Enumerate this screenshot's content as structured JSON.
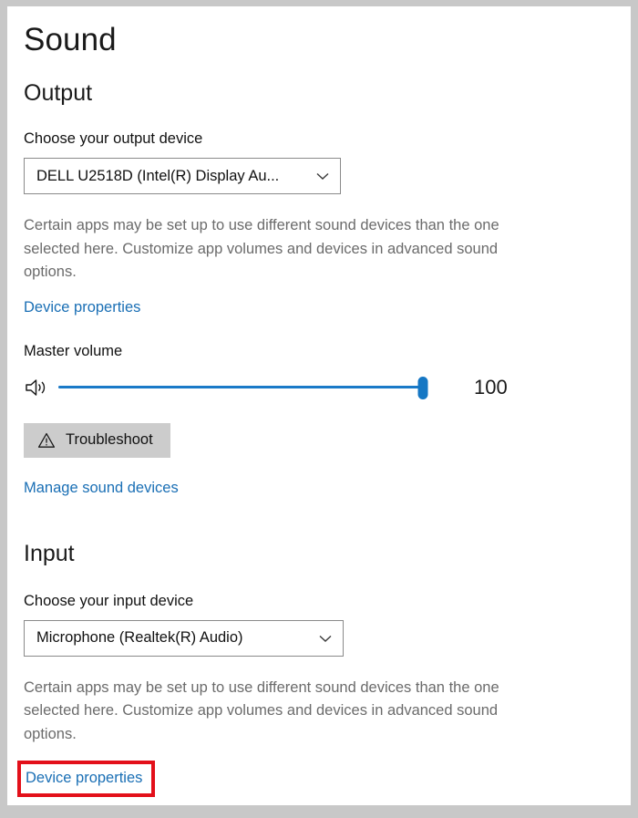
{
  "page": {
    "title": "Sound"
  },
  "output": {
    "heading": "Output",
    "device_label": "Choose your output device",
    "device_value": "DELL U2518D (Intel(R) Display Au...",
    "description": "Certain apps may be set up to use different sound devices than the one selected here. Customize app volumes and devices in advanced sound options.",
    "device_properties_link": "Device properties",
    "volume_label": "Master volume",
    "volume_value": "100",
    "volume_percent": 100,
    "troubleshoot_button": "Troubleshoot",
    "manage_devices_link": "Manage sound devices"
  },
  "input": {
    "heading": "Input",
    "device_label": "Choose your input device",
    "device_value": "Microphone (Realtek(R) Audio)",
    "description": "Certain apps may be set up to use different sound devices than the one selected here. Customize app volumes and devices in advanced sound options.",
    "device_properties_link": "Device properties"
  },
  "colors": {
    "link": "#1a6fb5",
    "accent": "#1577c4",
    "highlight": "#e3101a",
    "button_bg": "#cccccc",
    "frame": "#c8c8c8"
  },
  "icons": {
    "chevron": "chevron-down-icon",
    "speaker": "speaker-volume-icon",
    "warning": "warning-triangle-icon"
  }
}
